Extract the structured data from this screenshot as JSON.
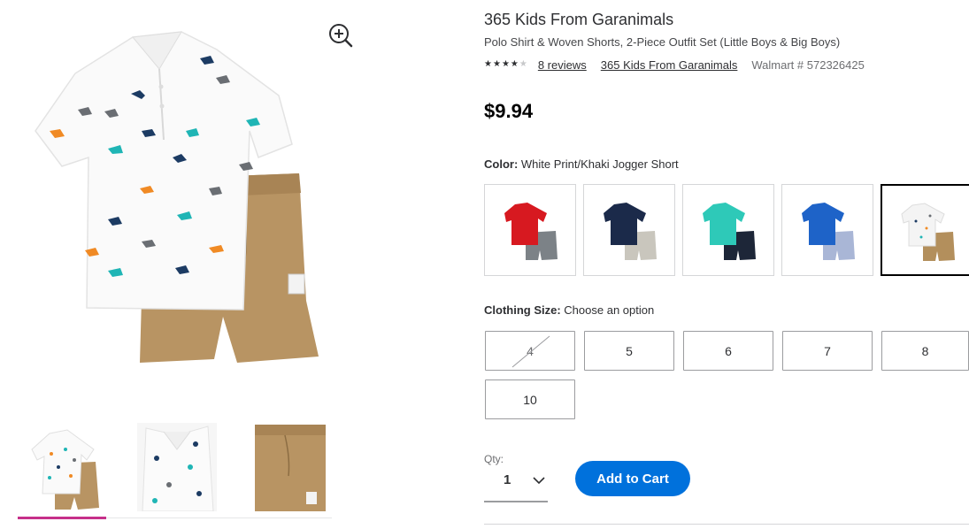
{
  "product": {
    "brand_title": "365 Kids From Garanimals",
    "name": "Polo Shirt & Woven Shorts, 2-Piece Outfit Set (Little Boys & Big Boys)",
    "rating": 4,
    "rating_max": 5,
    "reviews_text": "8 reviews",
    "brand_link": "365 Kids From Garanimals",
    "sku_text": "Walmart # 572326425",
    "price": "$9.94"
  },
  "color": {
    "label": "Color:",
    "selected_value": "White Print/Khaki Jogger Short",
    "swatches": [
      {
        "shirt": "#d71920",
        "shorts": "#7c8287"
      },
      {
        "shirt": "#1b2a4a",
        "shorts": "#c9c6bd"
      },
      {
        "shirt": "#2ec9b8",
        "shorts": "#1d2638"
      },
      {
        "shirt": "#1e63c8",
        "shorts": "#a9b6d6"
      },
      {
        "shirt": "#f4f4f4",
        "shorts": "#b38f5c"
      }
    ],
    "selected_index": 4
  },
  "size": {
    "label": "Clothing Size:",
    "prompt": "Choose an option",
    "options": [
      "4",
      "5",
      "6",
      "7",
      "8",
      "10"
    ],
    "unavailable": [
      "4"
    ]
  },
  "quantity": {
    "label": "Qty:",
    "value": "1"
  },
  "actions": {
    "add_to_cart": "Add to Cart"
  },
  "gallery": {
    "active_thumb": 0,
    "accent": "#c6308a"
  },
  "colors": {
    "primary_button": "#0071dc",
    "shorts_khaki": "#b38f5c"
  }
}
